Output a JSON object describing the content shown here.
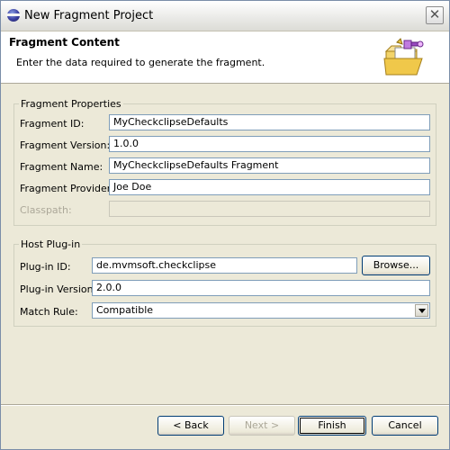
{
  "window": {
    "title": "New Fragment Project",
    "close_glyph": "✕"
  },
  "banner": {
    "title": "Fragment Content",
    "description": "Enter the data required to generate the fragment.",
    "icon": "folder-plugin-wizard-icon"
  },
  "fragment_properties": {
    "group_label": "Fragment Properties",
    "fields": [
      {
        "label": "Fragment ID:",
        "value": "MyCheckclipseDefaults",
        "enabled": true
      },
      {
        "label": "Fragment Version:",
        "value": "1.0.0",
        "enabled": true
      },
      {
        "label": "Fragment Name:",
        "value": "MyCheckclipseDefaults Fragment",
        "enabled": true
      },
      {
        "label": "Fragment Provider:",
        "value": "Joe Doe",
        "enabled": true
      },
      {
        "label": "Classpath:",
        "value": "",
        "enabled": false
      }
    ]
  },
  "host_plugin": {
    "group_label": "Host Plug-in",
    "plugin_id_label": "Plug-in ID:",
    "plugin_id_value": "de.mvmsoft.checkclipse",
    "browse_label": "Browse...",
    "plugin_version_label": "Plug-in Version:",
    "plugin_version_value": "2.0.0",
    "match_rule_label": "Match Rule:",
    "match_rule_value": "Compatible"
  },
  "buttons": {
    "back": "< Back",
    "next": "Next >",
    "finish": "Finish",
    "cancel": "Cancel"
  },
  "colors": {
    "dialog_bg": "#ece9d8",
    "field_border": "#7f9db9",
    "button_border": "#003c74"
  }
}
